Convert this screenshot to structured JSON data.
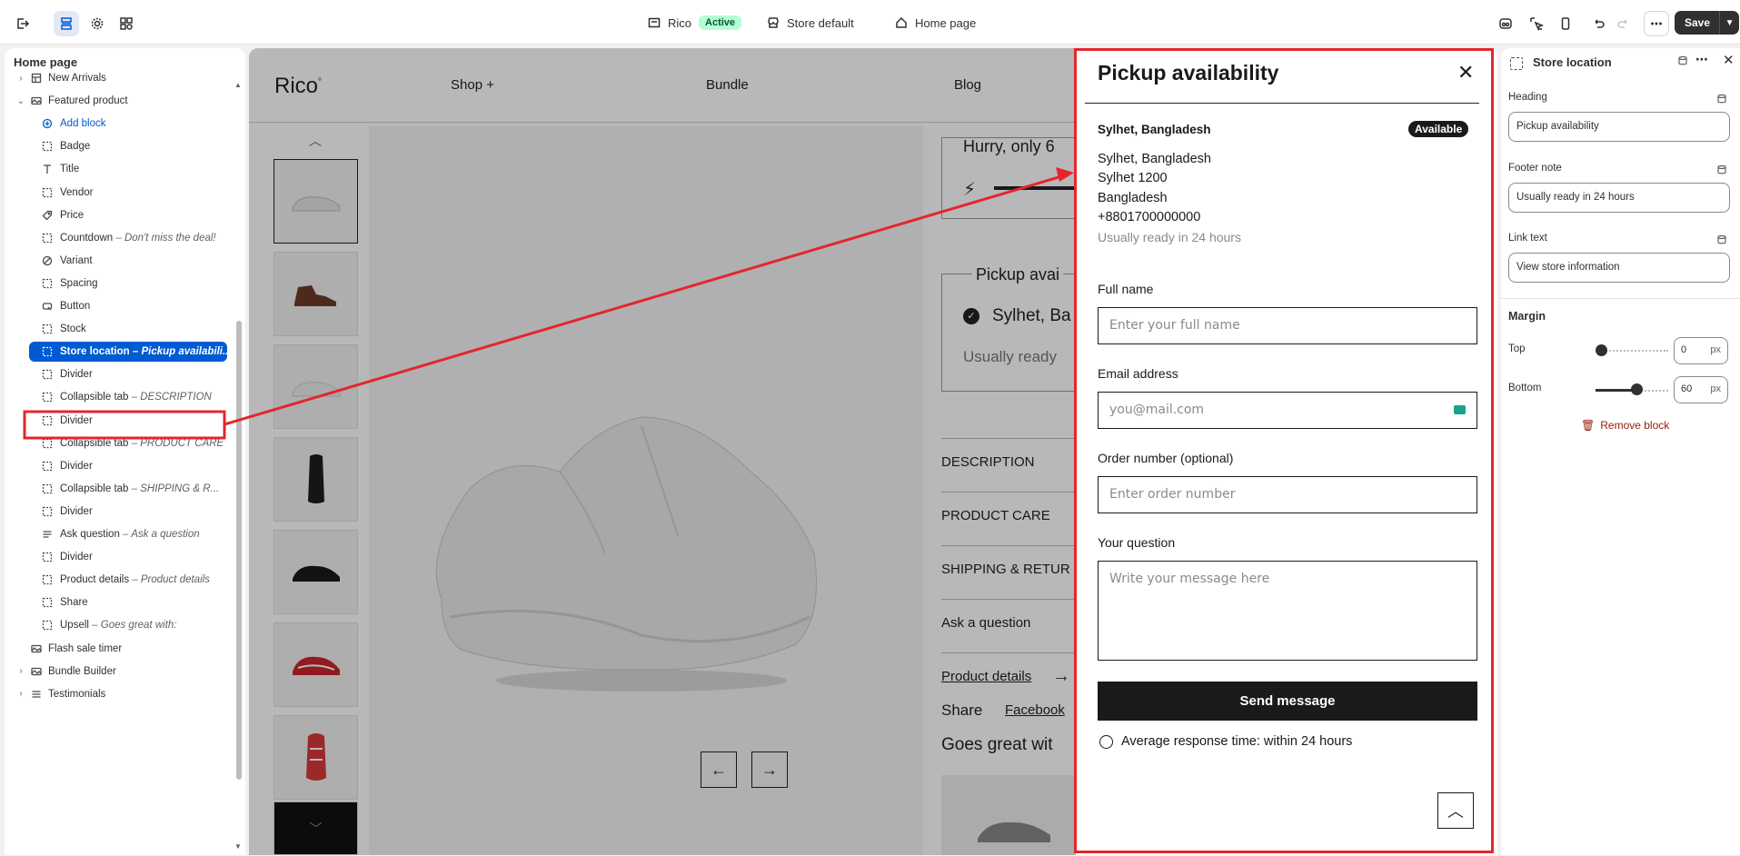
{
  "topbar": {
    "store_name": "Rico",
    "store_status": "Active",
    "theme": "Store default",
    "page": "Home page",
    "save_label": "Save"
  },
  "sidebar": {
    "title": "Home page",
    "items": [
      {
        "label": "New Arrivals",
        "note": "",
        "icon": "layout-icon",
        "level": 0,
        "chevron": "right"
      },
      {
        "label": "Featured product",
        "note": "",
        "icon": "image-icon",
        "level": 0,
        "chevron": "down"
      },
      {
        "label": "Add block",
        "note": "",
        "icon": "plus-circle-icon",
        "level": 1,
        "type": "add"
      },
      {
        "label": "Badge",
        "note": "",
        "icon": "block-icon",
        "level": 1
      },
      {
        "label": "Title",
        "note": "",
        "icon": "text-icon",
        "level": 1
      },
      {
        "label": "Vendor",
        "note": "",
        "icon": "block-icon",
        "level": 1
      },
      {
        "label": "Price",
        "note": "",
        "icon": "price-tag-icon",
        "level": 1
      },
      {
        "label": "Countdown",
        "note": "Don't miss the deal!",
        "icon": "block-icon",
        "level": 1
      },
      {
        "label": "Variant",
        "note": "",
        "icon": "variant-icon",
        "level": 1
      },
      {
        "label": "Spacing",
        "note": "",
        "icon": "block-icon",
        "level": 1
      },
      {
        "label": "Button",
        "note": "",
        "icon": "button-icon",
        "level": 1
      },
      {
        "label": "Stock",
        "note": "",
        "icon": "block-icon",
        "level": 1
      },
      {
        "label": "Store location",
        "note": "Pickup availabili...",
        "icon": "block-icon",
        "level": 1,
        "selected": true
      },
      {
        "label": "Divider",
        "note": "",
        "icon": "block-icon",
        "level": 1
      },
      {
        "label": "Collapsible tab",
        "note": "DESCRIPTION",
        "icon": "block-icon",
        "level": 1
      },
      {
        "label": "Divider",
        "note": "",
        "icon": "block-icon",
        "level": 1
      },
      {
        "label": "Collapsible tab",
        "note": "PRODUCT CARE",
        "icon": "block-icon",
        "level": 1
      },
      {
        "label": "Divider",
        "note": "",
        "icon": "block-icon",
        "level": 1
      },
      {
        "label": "Collapsible tab",
        "note": "SHIPPING & R...",
        "icon": "block-icon",
        "level": 1
      },
      {
        "label": "Divider",
        "note": "",
        "icon": "block-icon",
        "level": 1
      },
      {
        "label": "Ask question",
        "note": "Ask a question",
        "icon": "lines-icon",
        "level": 1
      },
      {
        "label": "Divider",
        "note": "",
        "icon": "block-icon",
        "level": 1
      },
      {
        "label": "Product details",
        "note": "Product details",
        "icon": "block-icon",
        "level": 1
      },
      {
        "label": "Share",
        "note": "",
        "icon": "block-icon",
        "level": 1
      },
      {
        "label": "Upsell",
        "note": "Goes great with:",
        "icon": "block-icon",
        "level": 1
      },
      {
        "label": "Flash sale timer",
        "note": "",
        "icon": "image-icon",
        "level": 0
      },
      {
        "label": "Bundle Builder",
        "note": "",
        "icon": "image-icon",
        "level": 0,
        "chevron": "right"
      },
      {
        "label": "Testimonials",
        "note": "",
        "icon": "list-icon",
        "level": 0,
        "chevron": "right"
      }
    ]
  },
  "preview": {
    "logo": "Rico",
    "nav": [
      "Shop +",
      "Bundle",
      "Blog"
    ],
    "hurry": "Hurry, only 6",
    "pickup_partial": "Pickup avai",
    "pickup_loc_partial": "Sylhet, Ba",
    "usually_partial": "Usually ready",
    "tabs": [
      "DESCRIPTION",
      "PRODUCT CARE",
      "SHIPPING & RETUR"
    ],
    "ask": "Ask a question",
    "product_details": "Product details",
    "share": "Share",
    "facebook": "Facebook",
    "goes_great": "Goes great wit"
  },
  "drawer": {
    "title": "Pickup availability",
    "location_name": "Sylhet, Bangladesh",
    "status": "Available",
    "address": [
      "Sylhet, Bangladesh",
      "Sylhet 1200",
      "Bangladesh",
      "+8801700000000"
    ],
    "ready_note": "Usually ready in 24 hours",
    "full_name_label": "Full name",
    "full_name_placeholder": "Enter your full name",
    "email_label": "Email address",
    "email_placeholder": "you@mail.com",
    "order_label": "Order number (optional)",
    "order_placeholder": "Enter order number",
    "question_label": "Your question",
    "question_placeholder": "Write your message here",
    "send_label": "Send message",
    "response_time": "Average response time: within 24 hours"
  },
  "settings": {
    "title": "Store location",
    "heading_label": "Heading",
    "heading_value": "Pickup availability",
    "footer_label": "Footer note",
    "footer_value": "Usually ready in 24 hours",
    "link_label": "Link text",
    "link_value": "View store information",
    "margin_title": "Margin",
    "top_label": "Top",
    "top_value": "0",
    "bottom_label": "Bottom",
    "bottom_value": "60",
    "unit": "px",
    "remove_label": "Remove block"
  },
  "colors": {
    "accent": "#005bd3",
    "highlight": "#e4262c",
    "active_badge": "#b4fed2"
  }
}
